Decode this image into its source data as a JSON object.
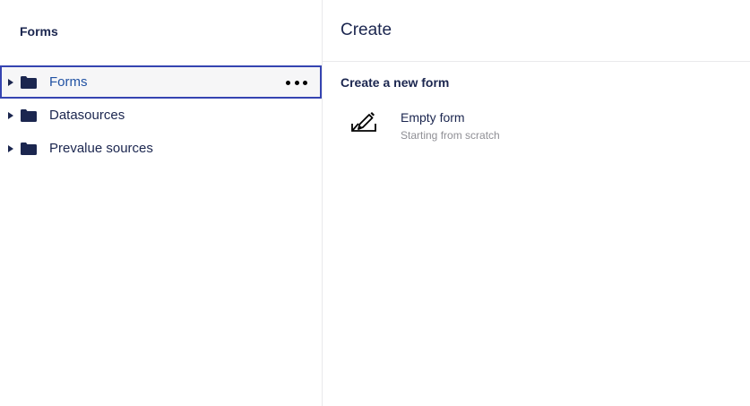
{
  "tree": {
    "header": "Forms",
    "items": [
      {
        "label": "Forms",
        "icon": "folder-icon",
        "selected": true
      },
      {
        "label": "Datasources",
        "icon": "folder-icon",
        "selected": false
      },
      {
        "label": "Prevalue sources",
        "icon": "folder-icon",
        "selected": false
      }
    ]
  },
  "create": {
    "title": "Create",
    "section_title": "Create a new form",
    "options": [
      {
        "title": "Empty form",
        "description": "Starting from scratch",
        "icon": "edit-pen-icon"
      }
    ]
  },
  "colors": {
    "text": "#1b264f",
    "selected_outline": "#3544b1",
    "selected_label": "#2152a3",
    "muted": "#8f8f95",
    "border": "#e9e9eb"
  }
}
